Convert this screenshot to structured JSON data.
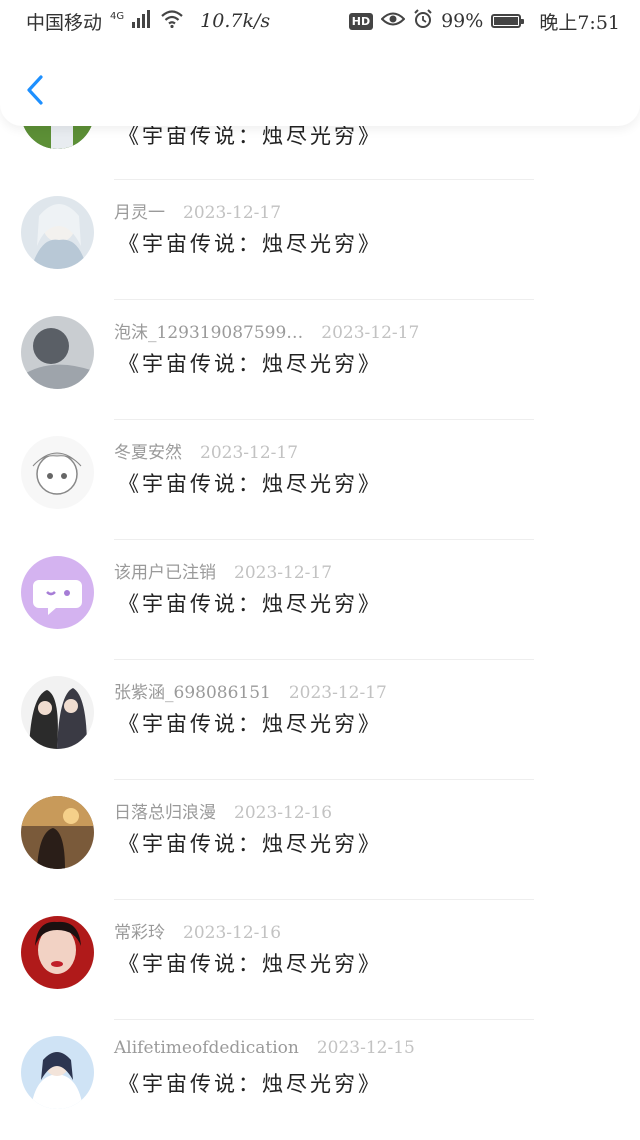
{
  "status_bar": {
    "carrier": "中国移动",
    "network": "4G",
    "speed": "10.7k/s",
    "hd": "HD",
    "battery": "99%",
    "time": "晚上7:51"
  },
  "header": {
    "back_icon": "chevron-left-icon",
    "accent_color": "#1e90ff"
  },
  "comments": [
    {
      "user": "",
      "date": "",
      "text": "《宇宙传说：烛尽光穷》",
      "avatar": "green-photo"
    },
    {
      "user": "月灵一",
      "date": "2023-12-17",
      "text": "《宇宙传说：烛尽光穷》",
      "avatar": "anime-girl-white"
    },
    {
      "user": "泡沫_129319087599…",
      "date": "2023-12-17",
      "text": "《宇宙传说：烛尽光穷》",
      "avatar": "grey-art"
    },
    {
      "user": "冬夏安然",
      "date": "2023-12-17",
      "text": "《宇宙传说：烛尽光穷》",
      "avatar": "sketch-anime"
    },
    {
      "user": "该用户已注销",
      "date": "2023-12-17",
      "text": "《宇宙传说：烛尽光穷》",
      "avatar": "default-purple"
    },
    {
      "user": "张紫涵_698086151",
      "date": "2023-12-17",
      "text": "《宇宙传说：烛尽光穷》",
      "avatar": "anime-pair"
    },
    {
      "user": "日落总归浪漫",
      "date": "2023-12-16",
      "text": "《宇宙传说：烛尽光穷》",
      "avatar": "sunset-girl"
    },
    {
      "user": "常彩玲",
      "date": "2023-12-16",
      "text": "《宇宙传说：烛尽光穷》",
      "avatar": "face-photo"
    },
    {
      "user": "Alifetimeofdedication",
      "date": "2023-12-15",
      "text": "《宇宙传说：烛尽光穷》",
      "avatar": "anime-blue"
    }
  ]
}
